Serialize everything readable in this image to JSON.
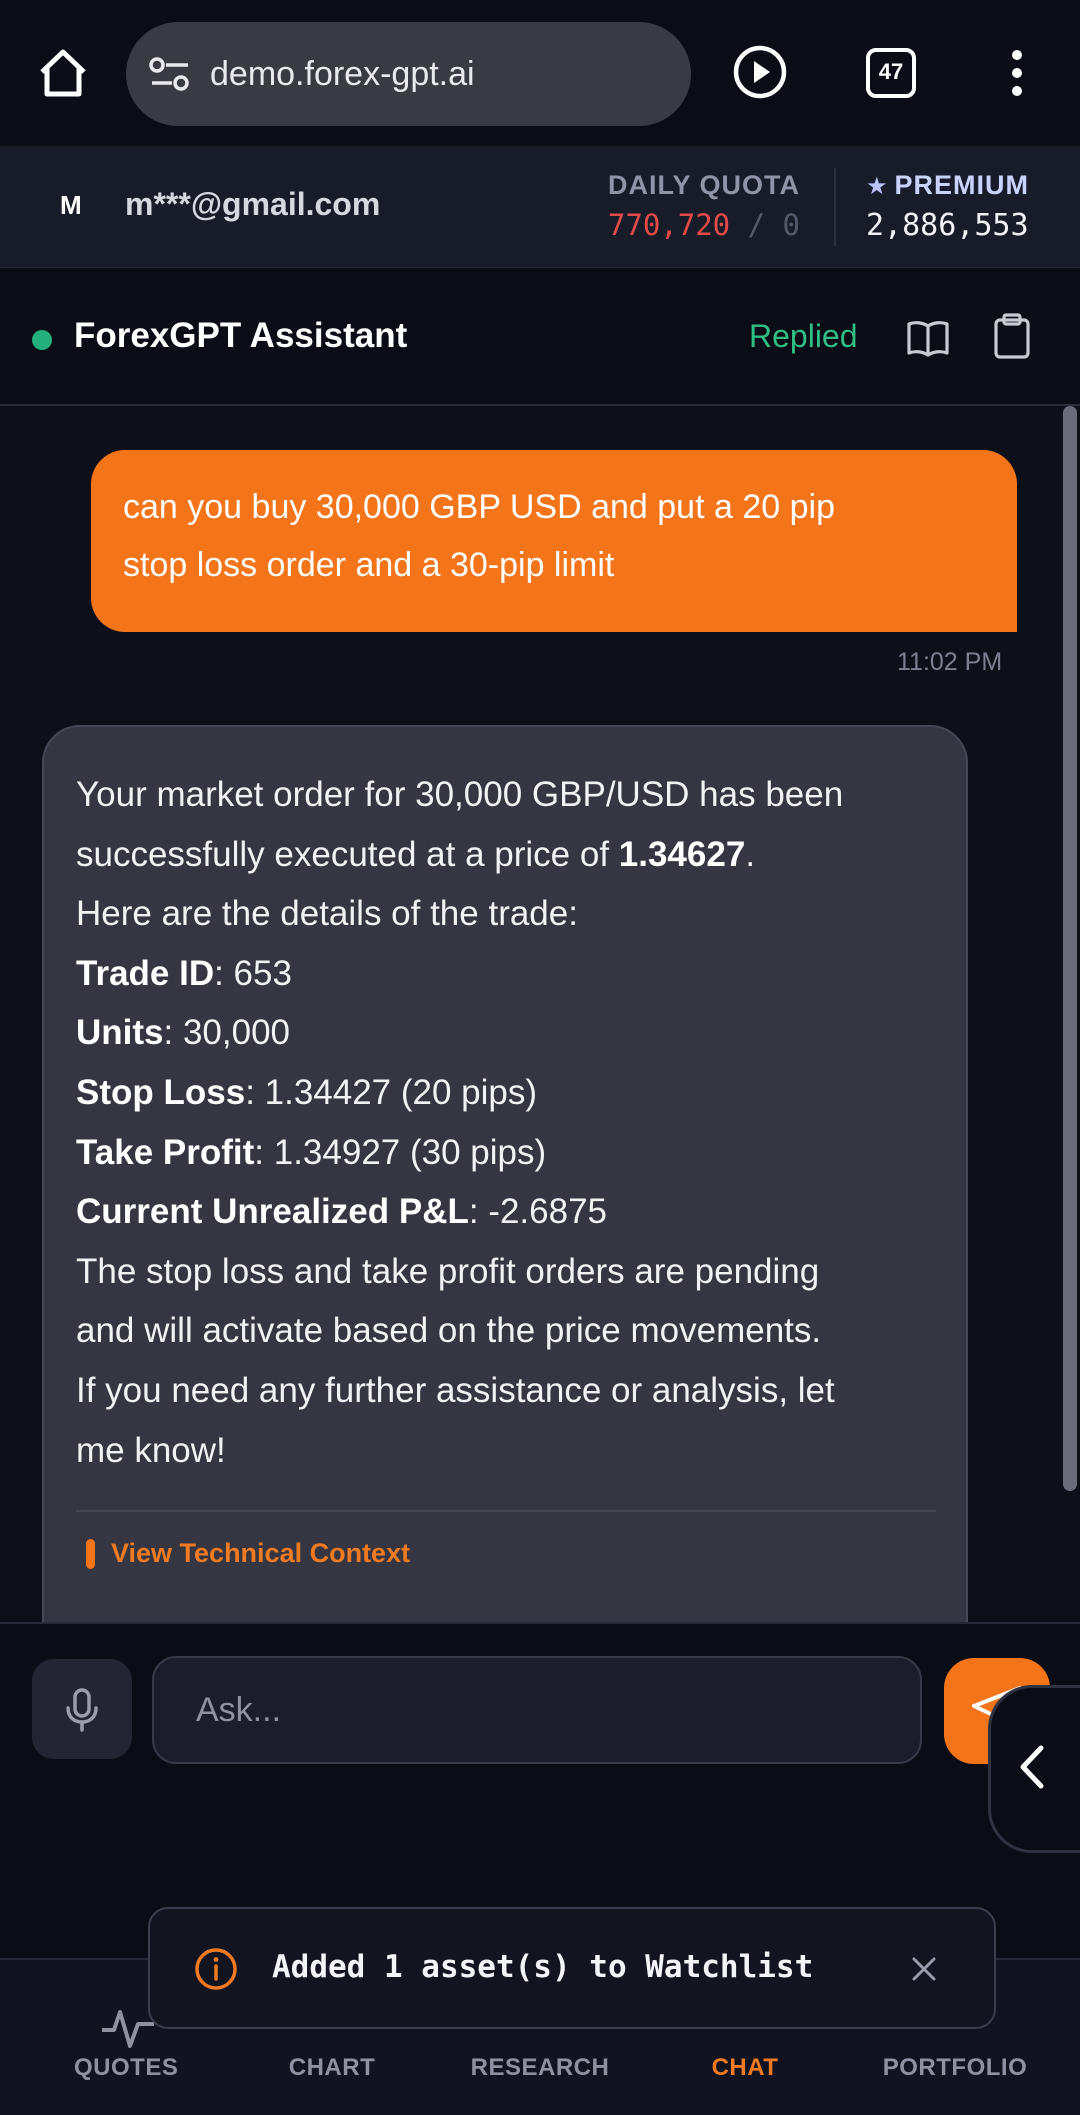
{
  "browser": {
    "url": "demo.forex-gpt.ai",
    "tab_count": "47"
  },
  "account": {
    "avatar_initial": "M",
    "email": "m***@gmail.com",
    "quota_label": "DAILY QUOTA",
    "quota_used": "770,720",
    "quota_separator": "/",
    "quota_limit": "0",
    "premium_label": "PREMIUM",
    "premium_value": "2,886,553"
  },
  "assistant": {
    "title": "ForexGPT Assistant",
    "status": "Replied",
    "status_color": "#2fbf84"
  },
  "chat": {
    "user_message": {
      "lines": [
        "can you buy 30,000 GBP USD and put a 20 pip",
        "stop loss order and a 30-pip limit"
      ],
      "time": "11:02 PM"
    },
    "bot_message": {
      "line1": "Your market order for 30,000 GBP/USD has been",
      "line2_pre": "successfully executed at a price of ",
      "line2_price": "1.34627",
      "line2_post": ".",
      "line3": "Here are the details of the trade:",
      "trade_id_label": "Trade ID",
      "trade_id_value": ": 653",
      "units_label": "Units",
      "units_value": ": 30,000",
      "stop_loss_label": "Stop Loss",
      "stop_loss_value": ": 1.34427 (20 pips)",
      "take_profit_label": "Take Profit",
      "take_profit_value": ": 1.34927 (30 pips)",
      "pnl_label": "Current Unrealized P&L",
      "pnl_value": ": -2.6875",
      "closing_lines": [
        "The stop loss and take profit orders are pending",
        "and will activate based on the price movements.",
        "If you need any further assistance or analysis, let",
        "me know!"
      ],
      "technical_context_link": "View Technical Context"
    }
  },
  "input": {
    "placeholder": "Ask..."
  },
  "nav": {
    "items": [
      "QUOTES",
      "CHART",
      "RESEARCH",
      "CHAT",
      "PORTFOLIO"
    ],
    "active": "CHAT",
    "accent_color": "#f07a22"
  },
  "toast": {
    "message": "Added 1 asset(s) to Watchlist"
  }
}
